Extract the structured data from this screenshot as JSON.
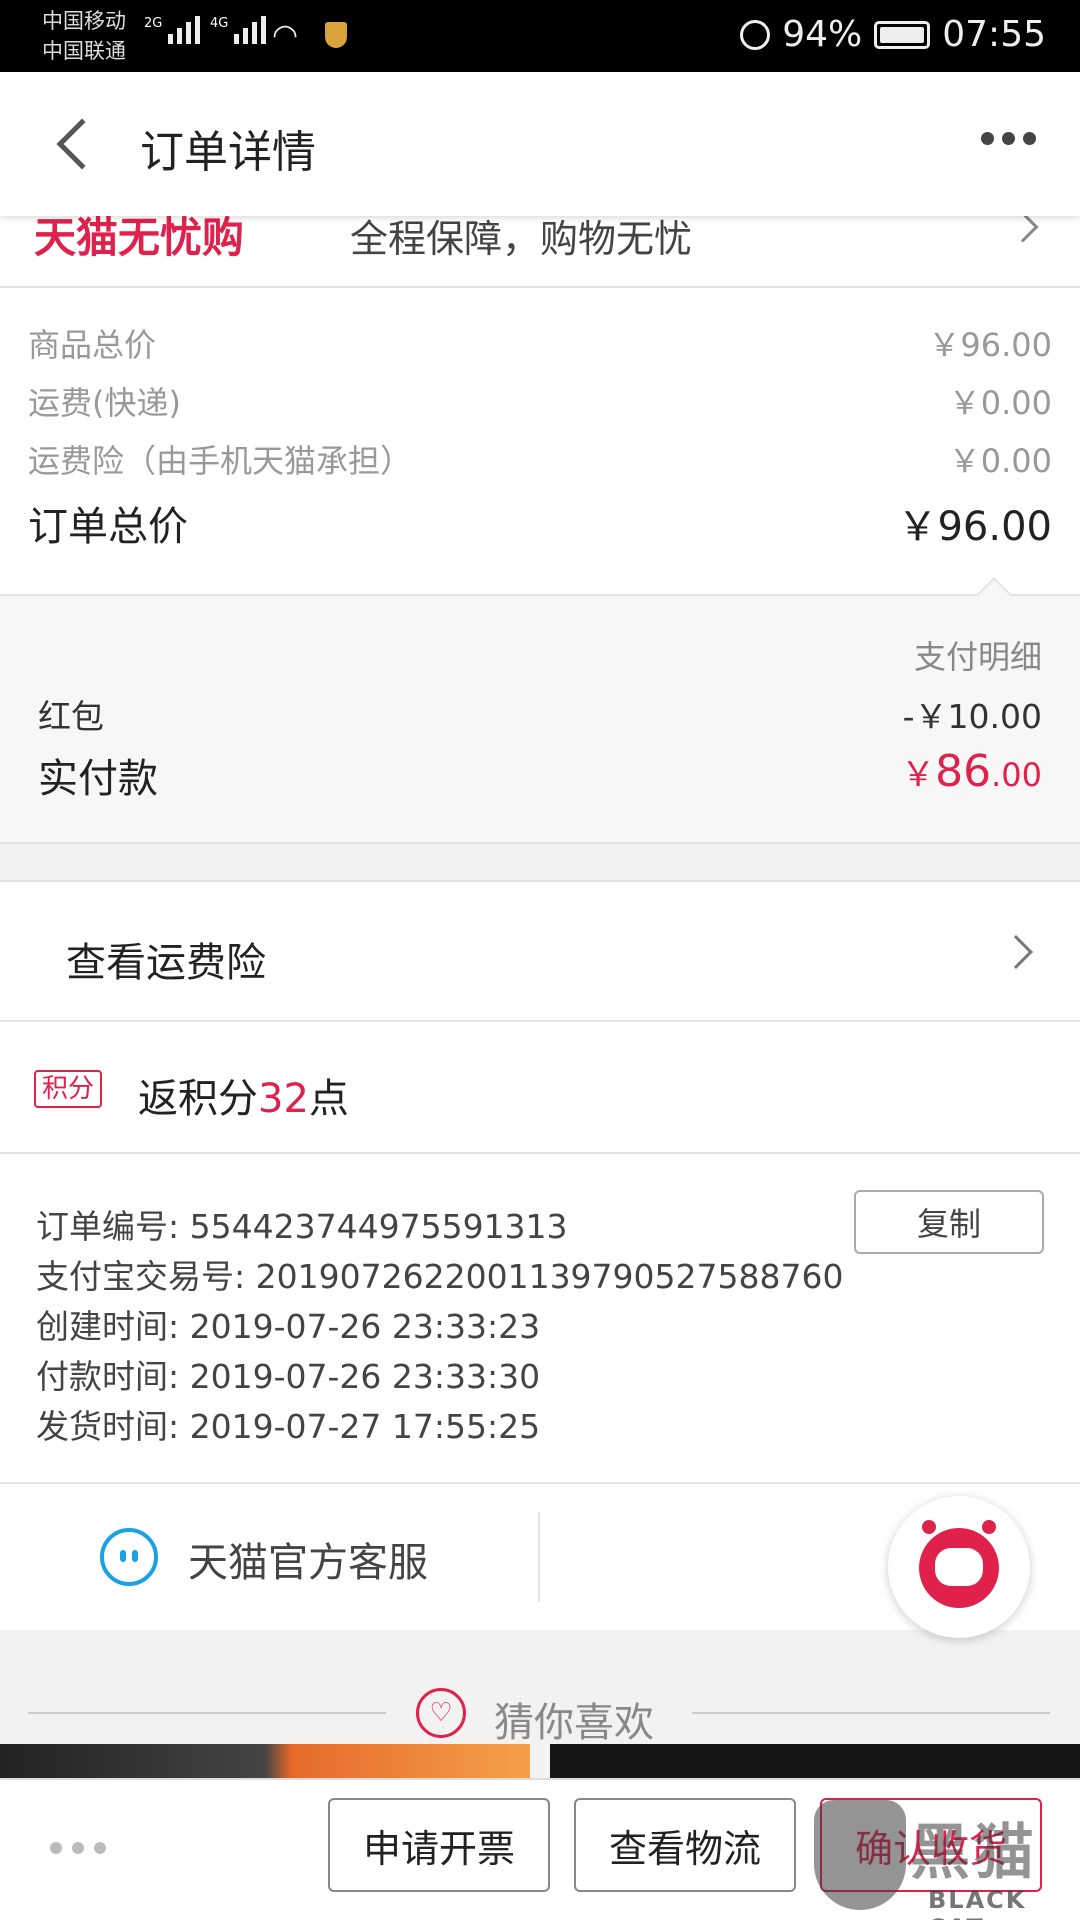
{
  "status_bar": {
    "carrier_1": "中国移动",
    "carrier_2": "中国联通",
    "net_1": "2G",
    "net_2": "4G",
    "battery": "94%",
    "time": "07:55"
  },
  "header": {
    "title": "订单详情"
  },
  "guarantee": {
    "logo": "天猫无忧购",
    "text": "全程保障，购物无忧"
  },
  "prices": {
    "goods_total_label": "商品总价",
    "goods_total_value": "￥96.00",
    "shipping_label": "运费(快递)",
    "shipping_value": "￥0.00",
    "insurance_label": "运费险（由手机天猫承担）",
    "insurance_value": "￥0.00",
    "order_total_label": "订单总价",
    "order_total_value": "￥96.00"
  },
  "payment": {
    "title": "支付明细",
    "red_packet_label": "红包",
    "red_packet_value": "-￥10.00",
    "paid_label": "实付款",
    "paid_currency": "￥",
    "paid_integer": "86",
    "paid_decimal": ".00"
  },
  "insurance_link": {
    "label": "查看运费险"
  },
  "points": {
    "badge": "积分",
    "prefix": "返积分",
    "number": "32",
    "suffix": "点"
  },
  "order_info": {
    "order_no_label": "订单编号:",
    "order_no": "554423744975591313",
    "copy_label": "复制",
    "alipay_label": "支付宝交易号:",
    "alipay_no": "2019072622001139790527588760",
    "created_label": "创建时间:",
    "created_time": "2019-07-26 23:33:23",
    "paid_label": "付款时间:",
    "paid_time": "2019-07-26 23:33:30",
    "shipped_label": "发货时间:",
    "shipped_time": "2019-07-27 17:55:25"
  },
  "service": {
    "label": "天猫官方客服"
  },
  "guess": {
    "label": "猜你喜欢"
  },
  "bottom_bar": {
    "invoice_label": "申请开票",
    "logistics_label": "查看物流",
    "confirm_label": "确认收货"
  },
  "watermark": {
    "cn": "黑猫",
    "en": "BLACK CAT"
  },
  "colors": {
    "accent": "#e0214c",
    "service_blue": "#19a1e6"
  }
}
